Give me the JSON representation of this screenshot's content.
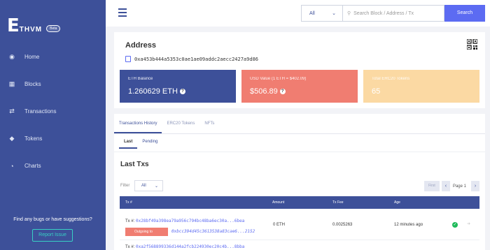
{
  "app": {
    "logo_mark": "E",
    "logo_text": "THVM",
    "logo_badge": "Beta"
  },
  "sidebar": {
    "items": [
      {
        "label": "Home",
        "icon": "dashboard-icon"
      },
      {
        "label": "Blocks",
        "icon": "cubes-icon"
      },
      {
        "label": "Transactions",
        "icon": "exchange-icon"
      },
      {
        "label": "Tokens",
        "icon": "ethereum-icon"
      },
      {
        "label": "Charts",
        "icon": "pie-chart-icon"
      }
    ],
    "feedback_text": "Find any bugs or have suggestions?",
    "report_label": "Report Issue"
  },
  "topbar": {
    "search_filter": "All",
    "search_placeholder": "Search Block / Address / Tx",
    "search_button": "Search"
  },
  "address": {
    "title": "Address",
    "hash": "0xa453b444a5353c0ae1ae09addc2aecc2427a9d86",
    "eth_balance_label": "ETH Balance",
    "eth_balance_value": "1.260629 ETH",
    "usd_value_label": "USD Value (1 ETH = $402.09)",
    "usd_value_value": "$506.89",
    "erc20_label": "Total ERC20 Tokens",
    "erc20_value": "65"
  },
  "colors": {
    "sidebar": "#3d5099",
    "accent": "#5c6bf2",
    "usd_tile": "#f07d71",
    "erc_tile": "#fbd9a3",
    "success": "#1fba5a"
  },
  "tabs": [
    "Transactions History",
    "ERC20 Tokens",
    "NFTs"
  ],
  "subtabs": [
    "Last",
    "Pending"
  ],
  "txs": {
    "title": "Last Txs",
    "filter_label": "Filter",
    "filter_value": "All",
    "pager_first": "First",
    "pager_text": "Page 1",
    "columns": {
      "tx": "Tx #",
      "amount": "Amount",
      "fee": "Tx Fee",
      "age": "Age"
    },
    "rows": [
      {
        "tx_label": "Tx #:",
        "hash": "0x28bf49a398ea79a956c794bc48ba6ec30a...6bea",
        "direction": "Outgoing to",
        "to": "0xbcc394d45c3613538a83cae6...2152",
        "amount": "0 ETH",
        "fee": "0.0025263",
        "age": "12 minutes ago"
      },
      {
        "tx_label": "Tx #:",
        "hash": "0xa2f568899336d144a2fcb224930ec20c4b...8bba"
      }
    ]
  }
}
